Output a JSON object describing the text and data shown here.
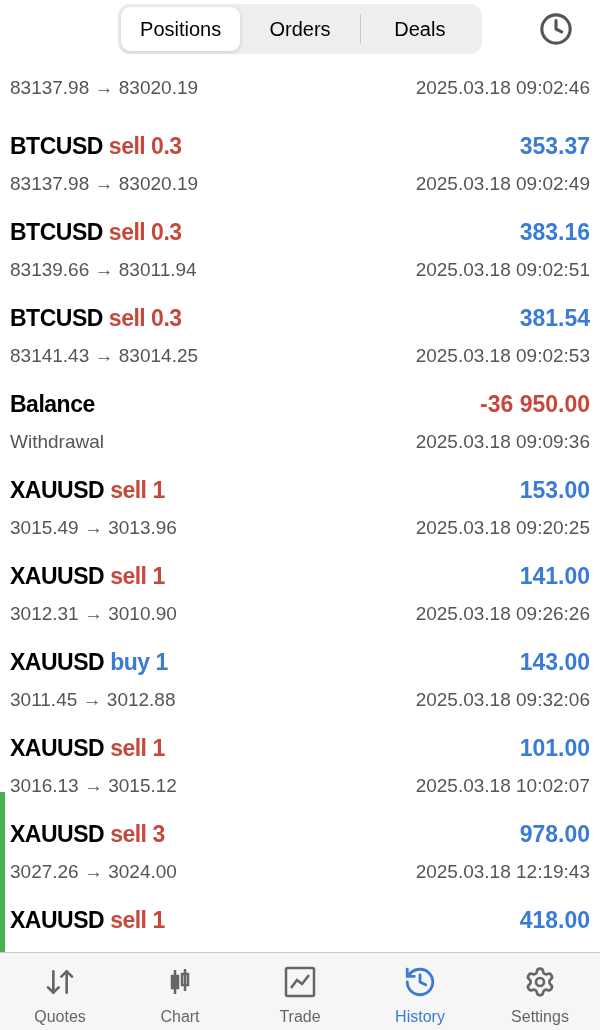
{
  "tabs": [
    {
      "label": "Positions",
      "selected": true
    },
    {
      "label": "Orders",
      "selected": false
    },
    {
      "label": "Deals",
      "selected": false
    }
  ],
  "deals": [
    {
      "kind": "partial",
      "prices": "83137.98 → 83020.19",
      "time": "2025.03.18 09:02:46",
      "highlighted": false
    },
    {
      "kind": "trade",
      "symbol": "BTCUSD",
      "action": "sell 0.3",
      "buy": false,
      "profit": "353.37",
      "loss": false,
      "prices": "83137.98 → 83020.19",
      "time": "2025.03.18 09:02:49",
      "highlighted": false
    },
    {
      "kind": "trade",
      "symbol": "BTCUSD",
      "action": "sell 0.3",
      "buy": false,
      "profit": "383.16",
      "loss": false,
      "prices": "83139.66 → 83011.94",
      "time": "2025.03.18 09:02:51",
      "highlighted": false
    },
    {
      "kind": "trade",
      "symbol": "BTCUSD",
      "action": "sell 0.3",
      "buy": false,
      "profit": "381.54",
      "loss": false,
      "prices": "83141.43 → 83014.25",
      "time": "2025.03.18 09:02:53",
      "highlighted": false
    },
    {
      "kind": "balance",
      "symbol": "Balance",
      "profit": "-36 950.00",
      "loss": true,
      "prices": "Withdrawal",
      "time": "2025.03.18 09:09:36",
      "highlighted": false
    },
    {
      "kind": "trade",
      "symbol": "XAUUSD",
      "action": "sell 1",
      "buy": false,
      "profit": "153.00",
      "loss": false,
      "prices": "3015.49 → 3013.96",
      "time": "2025.03.18 09:20:25",
      "highlighted": false
    },
    {
      "kind": "trade",
      "symbol": "XAUUSD",
      "action": "sell 1",
      "buy": false,
      "profit": "141.00",
      "loss": false,
      "prices": "3012.31 → 3010.90",
      "time": "2025.03.18 09:26:26",
      "highlighted": false
    },
    {
      "kind": "trade",
      "symbol": "XAUUSD",
      "action": "buy 1",
      "buy": true,
      "profit": "143.00",
      "loss": false,
      "prices": "3011.45 → 3012.88",
      "time": "2025.03.18 09:32:06",
      "highlighted": false
    },
    {
      "kind": "trade",
      "symbol": "XAUUSD",
      "action": "sell 1",
      "buy": false,
      "profit": "101.00",
      "loss": false,
      "prices": "3016.13 → 3015.12",
      "time": "2025.03.18 10:02:07",
      "highlighted": false
    },
    {
      "kind": "trade",
      "symbol": "XAUUSD",
      "action": "sell 3",
      "buy": false,
      "profit": "978.00",
      "loss": false,
      "prices": "3027.26 → 3024.00",
      "time": "2025.03.18 12:19:43",
      "highlighted": true
    },
    {
      "kind": "trade",
      "symbol": "XAUUSD",
      "action": "sell 1",
      "buy": false,
      "profit": "418.00",
      "loss": false,
      "highlighted": true
    }
  ],
  "nav": [
    {
      "label": "Quotes",
      "selected": false
    },
    {
      "label": "Chart",
      "selected": false
    },
    {
      "label": "Trade",
      "selected": false
    },
    {
      "label": "History",
      "selected": true
    },
    {
      "label": "Settings",
      "selected": false
    }
  ]
}
